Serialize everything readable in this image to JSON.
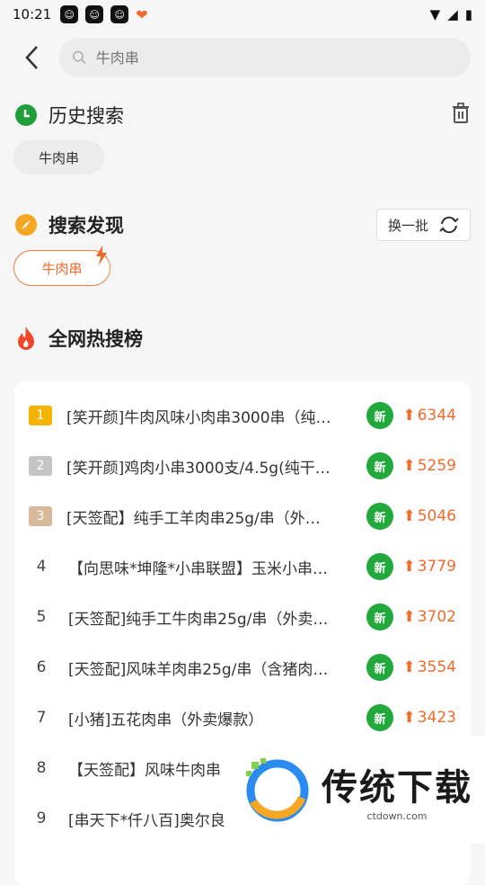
{
  "status": {
    "time": "10:21"
  },
  "search": {
    "placeholder": "牛肉串"
  },
  "history": {
    "title": "历史搜索",
    "items": [
      {
        "label": "牛肉串"
      }
    ]
  },
  "discover": {
    "title": "搜索发现",
    "refresh_label": "换一批",
    "items": [
      {
        "label": "牛肉串"
      }
    ]
  },
  "hot": {
    "title": "全网热搜榜",
    "rows": [
      {
        "rank": "1",
        "text": "[笑开颜]牛肉风味小肉串3000串（纯…",
        "badge": "新",
        "score": "6344"
      },
      {
        "rank": "2",
        "text": "[笑开颜]鸡肉小串3000支/4.5g(纯干…",
        "badge": "新",
        "score": "5259"
      },
      {
        "rank": "3",
        "text": "[天签配】纯手工羊肉串25g/串（外…",
        "badge": "新",
        "score": "5046"
      },
      {
        "rank": "4",
        "text": "【向思味*坤隆*小串联盟】玉米小串…",
        "badge": "新",
        "score": "3779"
      },
      {
        "rank": "5",
        "text": "[天签配]纯手工牛肉串25g/串（外卖…",
        "badge": "新",
        "score": "3702"
      },
      {
        "rank": "6",
        "text": "[天签配]风味羊肉串25g/串（含猪肉…",
        "badge": "新",
        "score": "3554"
      },
      {
        "rank": "7",
        "text": "[小猪]五花肉串（外卖爆款）",
        "badge": "新",
        "score": "3423"
      },
      {
        "rank": "8",
        "text": "【天签配】风味牛肉串",
        "badge": "",
        "score": ""
      },
      {
        "rank": "9",
        "text": "[串天下*仟八百]奥尔良",
        "badge": "",
        "score": ""
      }
    ]
  },
  "watermark": {
    "brand": "传统下载",
    "domain": "ctdown.com"
  },
  "colors": {
    "accent": "#f06b2b",
    "green": "#21a93b",
    "bg": "#f6f6f6"
  }
}
